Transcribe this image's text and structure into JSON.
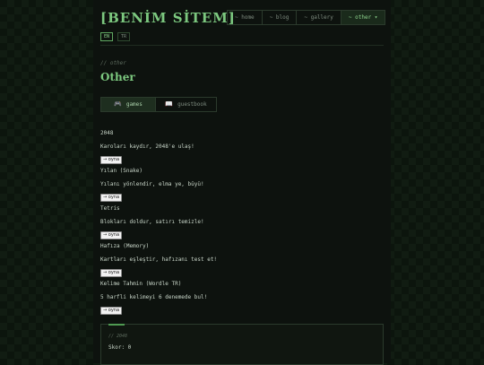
{
  "site": {
    "title": "[BENİM SİTEM]"
  },
  "nav": {
    "items": [
      {
        "label": "~ home"
      },
      {
        "label": "~ blog"
      },
      {
        "label": "~ gallery"
      },
      {
        "label": "~ other ▾"
      }
    ]
  },
  "langs": [
    {
      "label": "EN"
    },
    {
      "label": "TR"
    }
  ],
  "page": {
    "eyebrow": "// other",
    "title": "Other"
  },
  "tabs": [
    {
      "icon": "🎮",
      "label": "games"
    },
    {
      "icon": "📖",
      "label": "guestbook"
    }
  ],
  "games": [
    {
      "name": "2048",
      "desc": "Karoları kaydır, 2048'e ulaş!",
      "button": "→ oyna"
    },
    {
      "name": "Yılan (Snake)",
      "desc": "Yılanı yönlendir, elma ye, büyü!",
      "button": "→ oyna"
    },
    {
      "name": "Tetris",
      "desc": "Blokları doldur, satırı temizle!",
      "button": "→ oyna"
    },
    {
      "name": "Hafıza (Memory)",
      "desc": "Kartları eşleştir, hafızanı test et!",
      "button": "→ oyna"
    },
    {
      "name": "Kelime Tahmin (Wordle TR)",
      "desc": "5 harfli kelimeyi 6 denemede bul!",
      "button": "→ oyna"
    }
  ],
  "card": {
    "label": "// 2048",
    "score": "Skor: 0"
  },
  "colors": {
    "accent": "#7cc87f",
    "background": "#0d120e"
  }
}
